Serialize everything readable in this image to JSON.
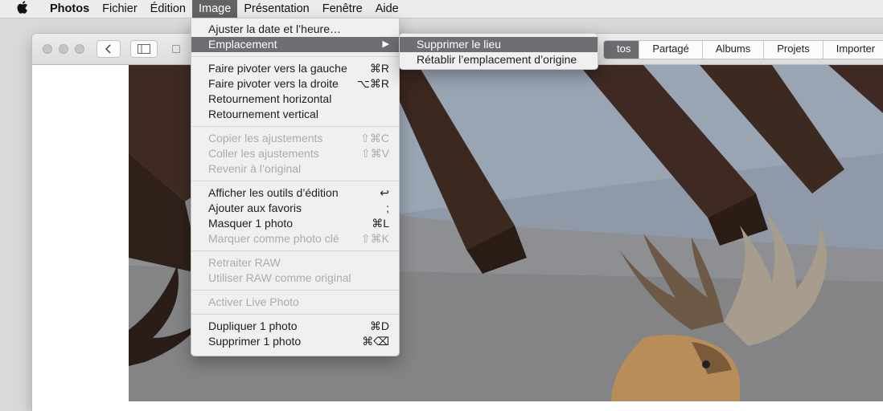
{
  "menubar": {
    "apple_icon": "apple-logo-icon",
    "items": [
      {
        "label": "Photos"
      },
      {
        "label": "Fichier"
      },
      {
        "label": "Édition"
      },
      {
        "label": "Image"
      },
      {
        "label": "Présentation"
      },
      {
        "label": "Fenêtre"
      },
      {
        "label": "Aide"
      }
    ]
  },
  "toolbar": {
    "back_icon": "chevron-left-icon",
    "sidebar_icon": "sidebar-toggle-icon",
    "tabs": [
      {
        "label": "tos"
      },
      {
        "label": "Partagé"
      },
      {
        "label": "Albums"
      },
      {
        "label": "Projets"
      },
      {
        "label": "Importer"
      }
    ]
  },
  "image_menu": {
    "items": [
      {
        "label": "Ajuster la date et l’heure…",
        "shortcut": ""
      },
      {
        "label": "Emplacement",
        "shortcut": "▶"
      },
      {
        "label": "Faire pivoter vers la gauche",
        "shortcut": "⌘R"
      },
      {
        "label": "Faire pivoter vers la droite",
        "shortcut": "⌥⌘R"
      },
      {
        "label": "Retournement horizontal",
        "shortcut": ""
      },
      {
        "label": "Retournement vertical",
        "shortcut": ""
      },
      {
        "label": "Copier les ajustements",
        "shortcut": "⇧⌘C"
      },
      {
        "label": "Coller les ajustements",
        "shortcut": "⇧⌘V"
      },
      {
        "label": "Revenir à l’original",
        "shortcut": ""
      },
      {
        "label": "Afficher les outils d’édition",
        "shortcut": "↩"
      },
      {
        "label": "Ajouter aux favoris",
        "shortcut": ";"
      },
      {
        "label": "Masquer 1 photo",
        "shortcut": "⌘L"
      },
      {
        "label": "Marquer comme photo clé",
        "shortcut": "⇧⌘K"
      },
      {
        "label": "Retraiter RAW",
        "shortcut": ""
      },
      {
        "label": "Utiliser RAW comme original",
        "shortcut": ""
      },
      {
        "label": "Activer Live Photo",
        "shortcut": ""
      },
      {
        "label": "Dupliquer 1 photo",
        "shortcut": "⌘D"
      },
      {
        "label": "Supprimer 1 photo",
        "shortcut": "⌘⌫"
      }
    ]
  },
  "location_submenu": {
    "items": [
      {
        "label": "Supprimer le lieu"
      },
      {
        "label": "Rétablir l’emplacement d’origine"
      }
    ]
  },
  "colors": {
    "highlight": "#6f6f73",
    "menu_bg": "#f0f0f0",
    "disabled_text": "#ababab"
  }
}
